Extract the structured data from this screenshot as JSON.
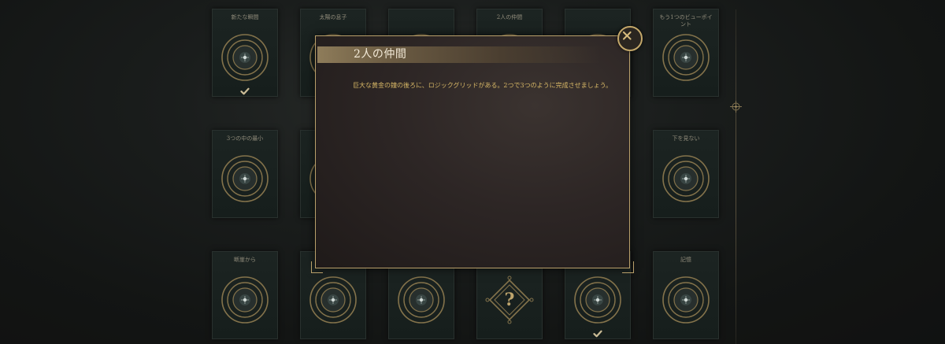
{
  "cards": [
    {
      "title": "新たな瞬間",
      "icon": "medallion-icon",
      "completed": true
    },
    {
      "title": "太陽の息子",
      "icon": "medallion-icon",
      "completed": false
    },
    {
      "title": "",
      "icon": "medallion-icon",
      "completed": false
    },
    {
      "title": "2人の仲間",
      "icon": "medallion-icon",
      "completed": false
    },
    {
      "title": "",
      "icon": "medallion-icon",
      "completed": false
    },
    {
      "title": "もう1つのビューポイント",
      "icon": "medallion-icon",
      "completed": false
    },
    {
      "title": "3つの中の最小",
      "icon": "medallion-icon",
      "completed": false
    },
    {
      "title": "",
      "icon": "medallion-icon",
      "completed": false
    },
    {
      "title": "下を見ない",
      "icon": "medallion-icon",
      "completed": false
    },
    {
      "title": "断崖から",
      "icon": "medallion-icon",
      "completed": false
    },
    {
      "title": "",
      "icon": "medallion-icon",
      "completed": false
    },
    {
      "title": "",
      "icon": "medallion-icon",
      "completed": false
    },
    {
      "title": "",
      "icon": "question-icon",
      "completed": false
    },
    {
      "title": "",
      "icon": "medallion-icon",
      "completed": true
    },
    {
      "title": "記憶",
      "icon": "medallion-icon",
      "completed": false
    }
  ],
  "dialog": {
    "title": "2人の仲間",
    "body": "巨大な黄金の鐘の後ろに、ロジックグリッドがある。2つで3つのように完成させましょう。"
  },
  "colors": {
    "gold": "#c4a86a",
    "gold_text": "#d7b766",
    "title_text": "#f3ead8",
    "card_bg": "#1c2422",
    "background": "#151716"
  }
}
